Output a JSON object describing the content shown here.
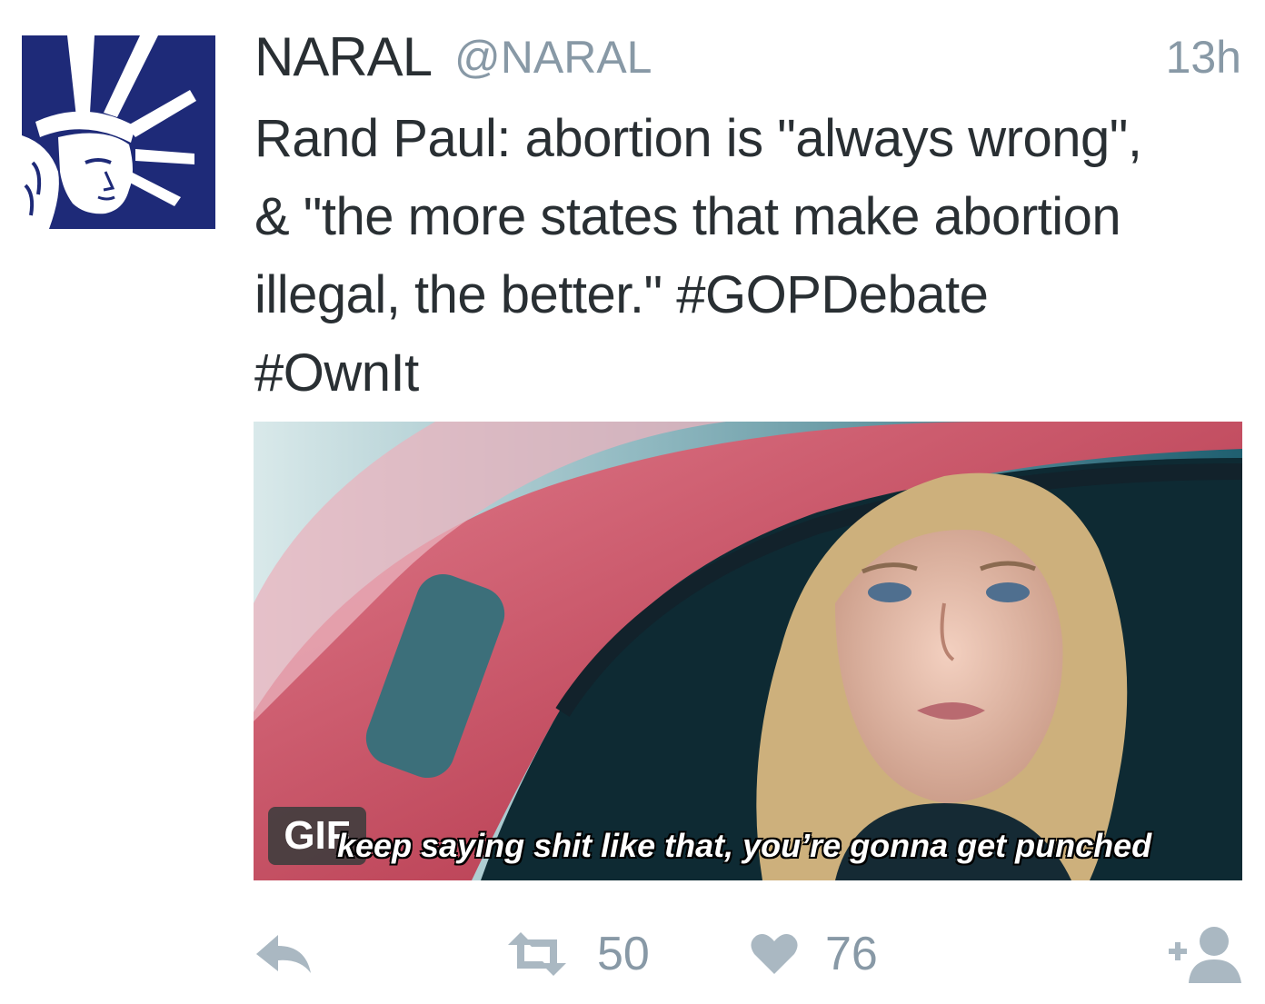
{
  "tweet": {
    "author_name": "NARAL",
    "author_handle": "@NARAL",
    "timestamp": "13h",
    "text_lines": [
      "Rand Paul: abortion is \"always wrong\",",
      "& \"the more states that make abortion",
      "illegal, the better.\" #GOPDebate",
      "#OwnIt"
    ]
  },
  "media": {
    "badge": "GIF",
    "caption": "keep saying shit like that, you’re gonna get punched"
  },
  "actions": {
    "reply_icon": "reply-icon",
    "retweet_icon": "retweet-icon",
    "retweet_count": "50",
    "like_icon": "heart-icon",
    "like_count": "76",
    "follow_icon": "follow-user-icon"
  },
  "colors": {
    "avatar_bg": "#1e2a78",
    "text": "#292f33",
    "muted": "#8899a6",
    "action_icon": "#aab8c2"
  }
}
